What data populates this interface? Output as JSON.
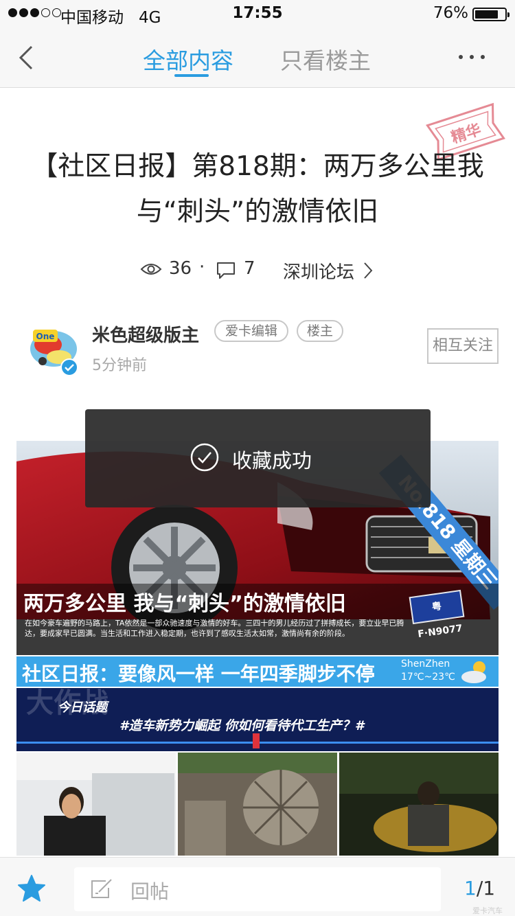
{
  "status_bar": {
    "carrier": "中国移动",
    "network": "4G",
    "time": "17:55",
    "battery_pct": "76%",
    "battery_level": 0.76
  },
  "nav": {
    "tab_all": "全部内容",
    "tab_owner": "只看楼主"
  },
  "stamp": {
    "text": "精华"
  },
  "post": {
    "title": "【社区日报】第818期：两万多公里我与“刺头”的激情依旧",
    "views": "36",
    "sep": "·",
    "comments": "7",
    "forum": "深圳论坛"
  },
  "author": {
    "name": "米色超级版主",
    "badges": [
      "爱卡编辑",
      "楼主"
    ],
    "time": "5分钟前",
    "follow_label": "相互关注",
    "avatar_text": "One"
  },
  "hero": {
    "ribbon": "No.818 星期三",
    "headline": "两万多公里 我与“刺头”的激情依旧",
    "description": "在如今豪车遍野的马路上，TA依然是一部众驰速度与激情的好车。三四十的男儿经历过了拼搏成长，要立业早已腾达，要成家早已圆满。当生活和工作进入稳定期，也许到了感叹生活太如常，激情尚有余的阶段。",
    "plate": "粤F·N9077",
    "daily_title": "社区日报：要像风一样 一年四季脚步不停",
    "city": "ShenZhen",
    "temp": "17℃~23℃",
    "topic_big": "大作战",
    "topic_label": "今日话题",
    "topic_text": "#造车新势力崛起 你如何看待代工生产？#"
  },
  "toast": {
    "text": "收藏成功"
  },
  "bottom": {
    "reply_label": "回帖",
    "page_current": "1",
    "page_total": "/1"
  },
  "watermark": "爱卡汽车",
  "colors": {
    "accent": "#2a9ce0",
    "stamp": "#e58a94"
  }
}
